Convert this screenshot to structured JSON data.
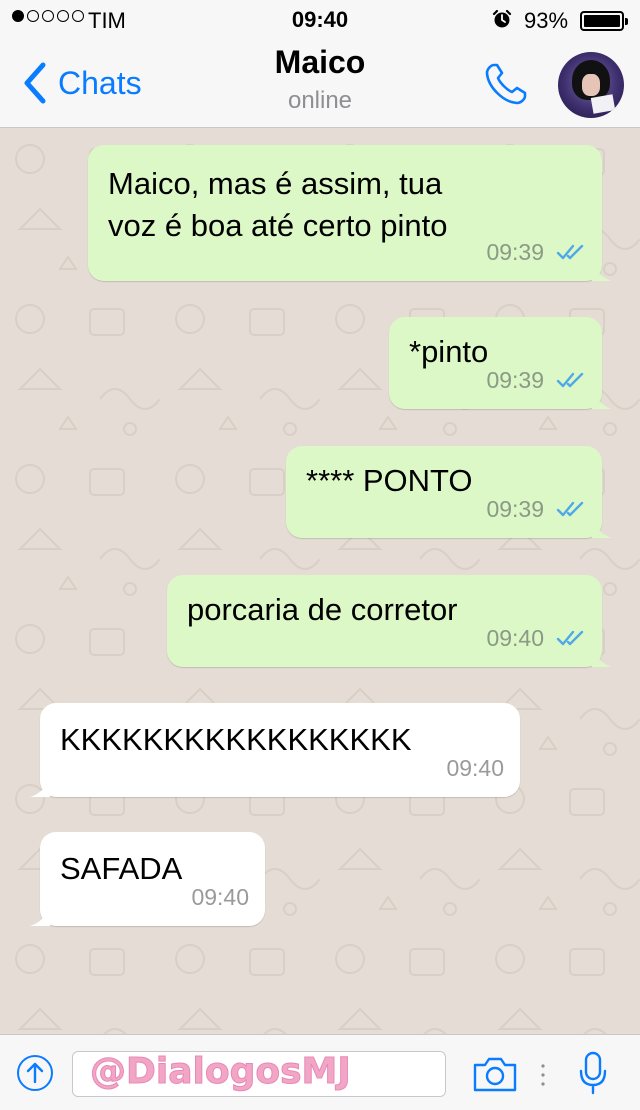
{
  "status_bar": {
    "carrier": "TIM",
    "time": "09:40",
    "battery": "93%",
    "signal_bars_filled": 1,
    "signal_bars_total": 5
  },
  "nav": {
    "back_label": "Chats",
    "contact_name": "Maico",
    "contact_status": "online"
  },
  "messages": [
    {
      "direction": "out",
      "lines": [
        "Maico, mas é assim, tua",
        "voz é boa até certo pinto"
      ],
      "time": "09:39",
      "read": true
    },
    {
      "direction": "out",
      "lines": [
        "*pinto"
      ],
      "time": "09:39",
      "read": true
    },
    {
      "direction": "out",
      "lines": [
        "**** PONTO"
      ],
      "time": "09:39",
      "read": true
    },
    {
      "direction": "out",
      "lines": [
        "porcaria de corretor"
      ],
      "time": "09:40",
      "read": true
    },
    {
      "direction": "in",
      "lines": [
        "KKKKKKKKKKKKKKKKK"
      ],
      "time": "09:40"
    },
    {
      "direction": "in",
      "lines": [
        "SAFADA"
      ],
      "time": "09:40"
    }
  ],
  "input": {
    "watermark": "@DialogosMJ"
  },
  "colors": {
    "accent": "#0a7cff",
    "outgoing_bubble": "#dcf8c6",
    "incoming_bubble": "#ffffff",
    "chat_background": "#e5ddd5",
    "read_ticks": "#4fa9e8",
    "watermark": "#f2a6c7"
  },
  "icons": [
    "chevron-left-icon",
    "phone-icon",
    "alarm-clock-icon",
    "battery-icon",
    "double-check-icon",
    "attach-arrow-icon",
    "camera-icon",
    "microphone-icon"
  ]
}
